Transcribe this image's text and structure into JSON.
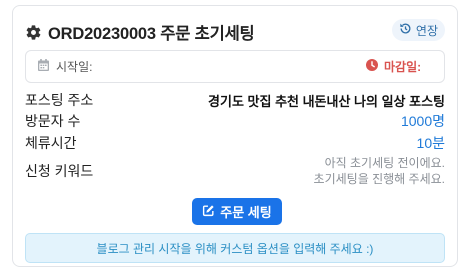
{
  "header": {
    "title": "ORD20230003 주문 초기세팅",
    "title_icon": "gear-icon",
    "extend_label": "연장",
    "extend_icon": "history-icon"
  },
  "dates": {
    "start_label": "시작일:",
    "start_icon": "calendar-icon",
    "end_label": "마감일:",
    "end_icon": "clock-icon"
  },
  "fields": {
    "posting_address": {
      "label": "포스팅 주소",
      "value": "경기도 맛집 추천 내돈내산 나의 일상 포스팅"
    },
    "visitors": {
      "label": "방문자 수",
      "value": "1000명"
    },
    "stay_time": {
      "label": "체류시간",
      "value": "10분"
    },
    "keywords": {
      "label": "신청 키워드",
      "line1": "아직 초기세팅 전이에요.",
      "line2": "초기세팅을 진행해 주세요."
    }
  },
  "order_button": {
    "label": "주문 세팅",
    "icon": "edit-icon"
  },
  "notice": "블로그 관리 시작을 위해 커스텀 옵션을 입력해 주세요 :)",
  "colors": {
    "accent": "#1a73e8",
    "danger": "#d9534f",
    "info_bg": "#e3f3fc"
  }
}
